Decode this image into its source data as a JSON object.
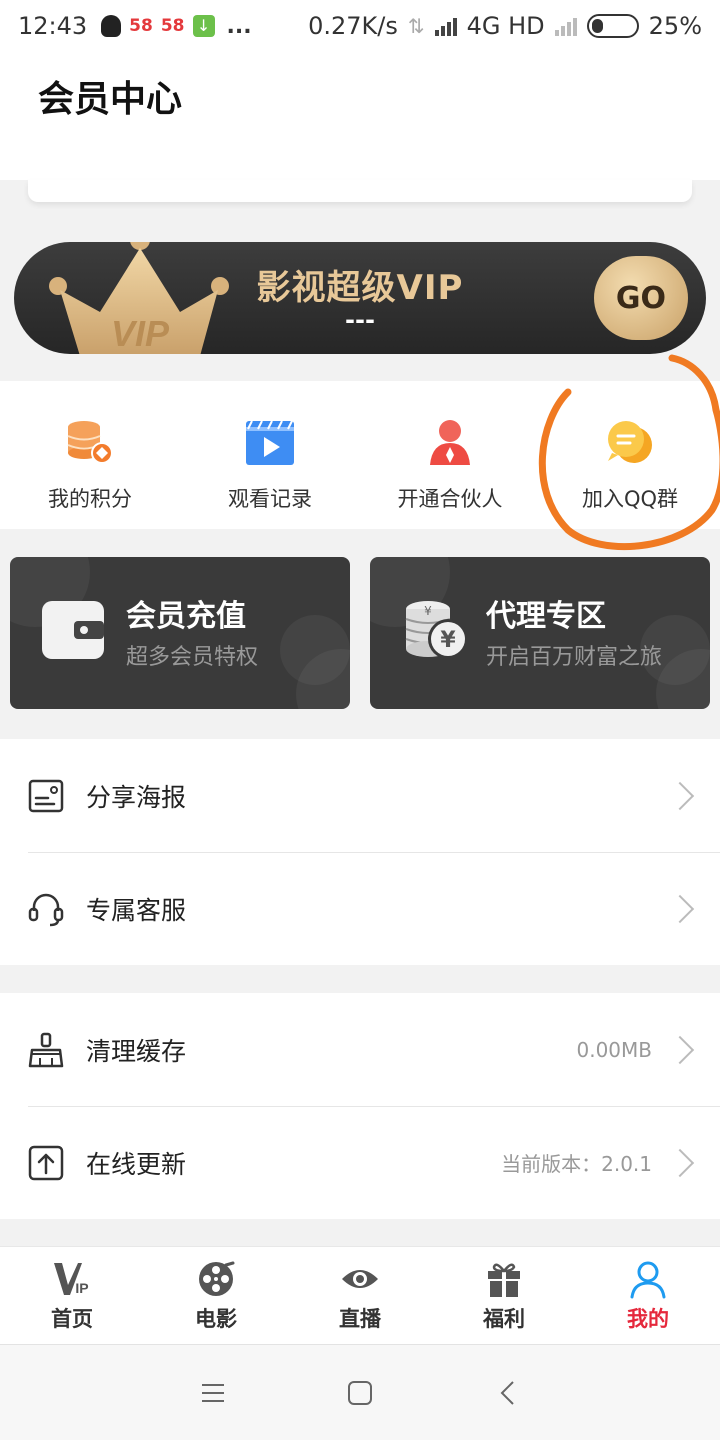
{
  "status_bar": {
    "time": "12:43",
    "net_speed": "0.27K/s",
    "network": "4G HD",
    "battery": "25%",
    "app_badge_1": "58",
    "app_badge_2": "58",
    "more": "..."
  },
  "header": {
    "title": "会员中心"
  },
  "vip_banner": {
    "title": "影视超级VIP",
    "subtitle": "---",
    "crown_text": "VIP",
    "go_label": "GO"
  },
  "quick_actions": [
    {
      "label": "我的积分",
      "icon": "coins-icon"
    },
    {
      "label": "观看记录",
      "icon": "video-play-icon"
    },
    {
      "label": "开通合伙人",
      "icon": "user-icon"
    },
    {
      "label": "加入QQ群",
      "icon": "chat-bubble-icon"
    }
  ],
  "promo_cards": [
    {
      "title": "会员充值",
      "subtitle": "超多会员特权",
      "icon": "wallet-icon"
    },
    {
      "title": "代理专区",
      "subtitle": "开启百万财富之旅",
      "icon": "coin-stack-icon"
    }
  ],
  "menu_group_1": [
    {
      "label": "分享海报",
      "icon": "poster-icon"
    },
    {
      "label": "专属客服",
      "icon": "headset-icon"
    }
  ],
  "menu_group_2": [
    {
      "label": "清理缓存",
      "icon": "broom-icon",
      "value": "0.00MB"
    },
    {
      "label": "在线更新",
      "icon": "upload-icon",
      "value": "当前版本：2.0.1"
    }
  ],
  "bottom_nav": [
    {
      "label": "首页",
      "icon": "vip-icon"
    },
    {
      "label": "电影",
      "icon": "film-reel-icon"
    },
    {
      "label": "直播",
      "icon": "eye-icon"
    },
    {
      "label": "福利",
      "icon": "gift-icon"
    },
    {
      "label": "我的",
      "icon": "person-icon",
      "active": true
    }
  ],
  "colors": {
    "accent": "#e5283c",
    "gold": "#e8c898",
    "dark_card": "#3a3a3a",
    "annotation": "#f07a22",
    "active_blue": "#1e9bf0"
  }
}
